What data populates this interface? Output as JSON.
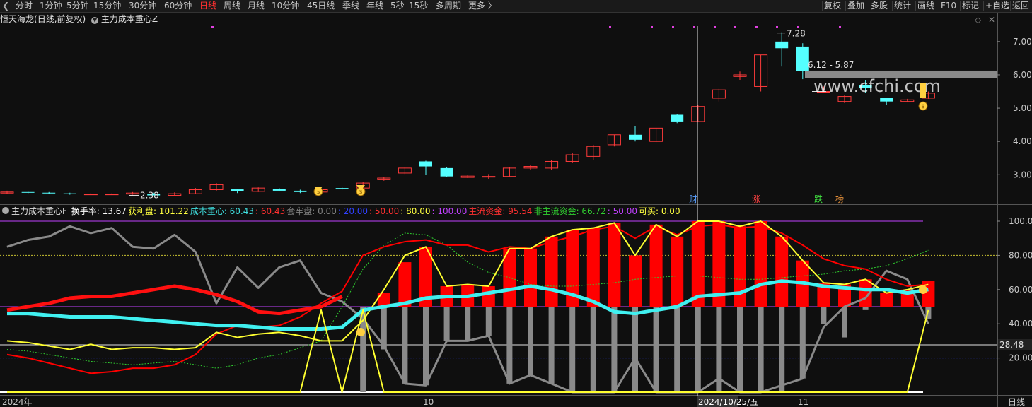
{
  "toolbar": {
    "back_icon": "back-arrow-icon",
    "periods": [
      "分时",
      "1分钟",
      "5分钟",
      "15分钟",
      "30分钟",
      "60分钟",
      "日线",
      "周线",
      "月线",
      "10分钟",
      "45日线",
      "季线",
      "年线",
      "5秒",
      "15秒",
      "多周期",
      "更多 〉"
    ],
    "active_period": "日线",
    "right_buttons": [
      "复权",
      "叠加",
      "多股",
      "统计",
      "画线",
      "F10",
      "标记",
      "+自选",
      "返回"
    ]
  },
  "stock_info": {
    "name": "恒天海龙",
    "mode": "(日线,前复权)",
    "indicator": "主力成本重心Z",
    "circle_icon": "dropdown-circle-icon"
  },
  "price_axis": [
    "7.00",
    "6.00",
    "5.00",
    "4.00",
    "3.00"
  ],
  "annotations": {
    "high": "7.28",
    "low": "2.38",
    "range": "6.12 - 5.87",
    "cai": "财",
    "zhang": "涨",
    "die": "跌",
    "bang": "榜",
    "watermark": "www.cfchi.com"
  },
  "indicator_title": {
    "name": "主力成本重心F",
    "items": [
      {
        "label": "换手率:",
        "value": "13.67",
        "color": "#ffffff"
      },
      {
        "label": "获利盘:",
        "value": "101.22",
        "color": "#ffff40"
      },
      {
        "label": "成本重心:",
        "value": "60.43",
        "color": "#40e0e0"
      },
      {
        "label": ":",
        "value": "60.43",
        "color": "#ff3030"
      },
      {
        "label": "套牢盘:",
        "value": "0.00",
        "color": "#808080"
      },
      {
        "label": ":",
        "value": "20.00",
        "color": "#3040ff"
      },
      {
        "label": ":",
        "value": "50.00",
        "color": "#ff3030"
      },
      {
        "label": ":",
        "value": "80.00",
        "color": "#ffff40"
      },
      {
        "label": ":",
        "value": "100.00",
        "color": "#c040ff"
      },
      {
        "label": "主流资金:",
        "value": "95.54",
        "color": "#ff3030"
      },
      {
        "label": "非主流资金:",
        "value": "66.72",
        "color": "#30d030"
      },
      {
        "label": ":",
        "value": "50.00",
        "color": "#c040ff"
      },
      {
        "label": "可买:",
        "value": "0.00",
        "color": "#ffff40"
      }
    ]
  },
  "indicator_axis": [
    "100.0",
    "80.00",
    "60.00",
    "40.00",
    "20.00"
  ],
  "crosshair_value": "28.48",
  "date_axis": {
    "labels": [
      "2024年",
      "10",
      "2024/10/25/五",
      "11"
    ],
    "period": "日线"
  },
  "colors": {
    "up": "#ff3b3b",
    "down": "#54ffff",
    "background": "#0f0f0f",
    "grid": "#333333"
  },
  "chart_data": {
    "type": "candlestick",
    "price_ylim": [
      2.2,
      7.4
    ],
    "candles": [
      {
        "o": 2.45,
        "c": 2.48,
        "h": 2.52,
        "l": 2.42
      },
      {
        "o": 2.48,
        "c": 2.46,
        "h": 2.5,
        "l": 2.43
      },
      {
        "o": 2.46,
        "c": 2.44,
        "h": 2.48,
        "l": 2.42
      },
      {
        "o": 2.44,
        "c": 2.42,
        "h": 2.46,
        "l": 2.4
      },
      {
        "o": 2.42,
        "c": 2.42,
        "h": 2.45,
        "l": 2.4
      },
      {
        "o": 2.42,
        "c": 2.42,
        "h": 2.44,
        "l": 2.4
      },
      {
        "o": 2.42,
        "c": 2.45,
        "h": 2.48,
        "l": 2.4
      },
      {
        "o": 2.42,
        "c": 2.38,
        "h": 2.46,
        "l": 2.38
      },
      {
        "o": 2.38,
        "c": 2.43,
        "h": 2.47,
        "l": 2.38
      },
      {
        "o": 2.43,
        "c": 2.55,
        "h": 2.6,
        "l": 2.42
      },
      {
        "o": 2.55,
        "c": 2.7,
        "h": 2.75,
        "l": 2.52
      },
      {
        "o": 2.56,
        "c": 2.5,
        "h": 2.58,
        "l": 2.45
      },
      {
        "o": 2.5,
        "c": 2.6,
        "h": 2.62,
        "l": 2.48
      },
      {
        "o": 2.57,
        "c": 2.52,
        "h": 2.6,
        "l": 2.5
      },
      {
        "o": 2.52,
        "c": 2.48,
        "h": 2.55,
        "l": 2.45
      },
      {
        "o": 2.48,
        "c": 2.55,
        "h": 2.6,
        "l": 2.46
      },
      {
        "o": 2.6,
        "c": 2.58,
        "h": 2.64,
        "l": 2.55
      },
      {
        "o": 2.6,
        "c": 2.75,
        "h": 2.78,
        "l": 2.58
      },
      {
        "o": 2.85,
        "c": 2.9,
        "h": 2.94,
        "l": 2.82
      },
      {
        "o": 3.05,
        "c": 3.2,
        "h": 3.22,
        "l": 3.02
      },
      {
        "o": 3.4,
        "c": 3.25,
        "h": 3.42,
        "l": 3.0
      },
      {
        "o": 3.2,
        "c": 2.95,
        "h": 3.22,
        "l": 2.93
      },
      {
        "o": 2.92,
        "c": 2.96,
        "h": 3.0,
        "l": 2.9
      },
      {
        "o": 2.95,
        "c": 2.95,
        "h": 3.02,
        "l": 2.88
      },
      {
        "o": 2.95,
        "c": 3.2,
        "h": 3.22,
        "l": 2.93
      },
      {
        "o": 3.2,
        "c": 3.25,
        "h": 3.3,
        "l": 3.15
      },
      {
        "o": 3.2,
        "c": 3.4,
        "h": 3.45,
        "l": 3.15
      },
      {
        "o": 3.4,
        "c": 3.6,
        "h": 3.65,
        "l": 3.35
      },
      {
        "o": 3.55,
        "c": 3.85,
        "h": 3.9,
        "l": 3.45
      },
      {
        "o": 3.9,
        "c": 4.2,
        "h": 4.2,
        "l": 3.85
      },
      {
        "o": 4.2,
        "c": 4.05,
        "h": 4.45,
        "l": 4.0
      },
      {
        "o": 4.0,
        "c": 4.4,
        "h": 4.4,
        "l": 3.98
      },
      {
        "o": 4.8,
        "c": 4.6,
        "h": 4.82,
        "l": 4.55
      },
      {
        "o": 4.6,
        "c": 5.05,
        "h": 5.1,
        "l": 4.58
      },
      {
        "o": 5.3,
        "c": 5.55,
        "h": 5.58,
        "l": 5.2
      },
      {
        "o": 5.95,
        "c": 6.0,
        "h": 6.1,
        "l": 5.85
      },
      {
        "o": 5.65,
        "c": 6.6,
        "h": 6.6,
        "l": 5.5
      },
      {
        "o": 7.0,
        "c": 6.8,
        "h": 7.28,
        "l": 6.25
      },
      {
        "o": 6.85,
        "c": 6.12,
        "h": 6.95,
        "l": 5.87
      },
      {
        "o": 5.5,
        "c": 5.5,
        "h": 5.65,
        "l": 5.45
      },
      {
        "o": 5.2,
        "c": 5.35,
        "h": 5.4,
        "l": 5.15
      },
      {
        "o": 5.7,
        "c": 5.6,
        "h": 5.85,
        "l": 5.45
      },
      {
        "o": 5.3,
        "c": 5.2,
        "h": 5.32,
        "l": 5.1
      },
      {
        "o": 5.2,
        "c": 5.25,
        "h": 5.28,
        "l": 5.18
      },
      {
        "o": 5.3,
        "c": 5.45,
        "h": 5.5,
        "l": 5.28
      }
    ],
    "indicator_ylim": [
      0,
      105
    ],
    "hist_red": [
      null,
      null,
      null,
      null,
      null,
      null,
      null,
      null,
      null,
      null,
      null,
      null,
      null,
      null,
      null,
      null,
      null,
      null,
      58,
      76,
      85,
      62,
      63,
      62,
      84,
      84,
      91,
      95,
      96,
      99,
      80,
      98,
      91,
      100,
      100,
      97,
      100,
      91,
      77,
      64,
      63,
      66,
      58,
      60,
      65
    ],
    "hist_gray": [
      null,
      null,
      null,
      null,
      null,
      null,
      null,
      null,
      null,
      null,
      null,
      null,
      null,
      null,
      null,
      null,
      null,
      0,
      25,
      5,
      4,
      30,
      30,
      33,
      5,
      10,
      5,
      0,
      0,
      0,
      0,
      0,
      0,
      0,
      0,
      0,
      0,
      0,
      8,
      40,
      32,
      48,
      54,
      58,
      43
    ],
    "gray_line": [
      85,
      89,
      91,
      97,
      93,
      96,
      85,
      84,
      92,
      82,
      52,
      73,
      61,
      73,
      77,
      58,
      53,
      43,
      27,
      5,
      4,
      30,
      30,
      33,
      5,
      10,
      5,
      0,
      0,
      0,
      20,
      0,
      0,
      0,
      8,
      0,
      0,
      4,
      8,
      38,
      50,
      55,
      71,
      66,
      40
    ],
    "cyan_line": [
      46,
      46,
      45,
      44,
      44,
      44,
      43,
      42,
      41,
      40,
      39,
      39,
      38,
      37,
      37,
      37,
      38,
      48,
      50,
      52,
      55,
      56,
      56,
      58,
      60,
      62,
      60,
      57,
      53,
      47,
      46,
      48,
      50,
      56,
      57,
      58,
      63,
      65,
      64,
      62,
      61,
      60,
      60,
      58,
      60
    ],
    "red_line": [
      22,
      20,
      17,
      14,
      11,
      12,
      14,
      14,
      16,
      22,
      34,
      39,
      38,
      39,
      44,
      52,
      59,
      80,
      85,
      88,
      89,
      86,
      86,
      82,
      85,
      84,
      88,
      91,
      95,
      97,
      90,
      97,
      92,
      97,
      98,
      96,
      97,
      93,
      86,
      78,
      74,
      72,
      66,
      62,
      63
    ],
    "yellow_line": [
      30,
      29,
      27,
      25,
      28,
      25,
      26,
      26,
      25,
      26,
      35,
      32,
      34,
      35,
      33,
      30,
      30,
      42,
      60,
      80,
      85,
      62,
      63,
      62,
      84,
      84,
      91,
      95,
      96,
      99,
      80,
      98,
      91,
      100,
      100,
      97,
      100,
      91,
      77,
      64,
      63,
      66,
      58,
      60,
      63
    ],
    "green_dotted": [
      25,
      24,
      22,
      20,
      18,
      17,
      16,
      17,
      18,
      16,
      14,
      16,
      20,
      22,
      26,
      30,
      50,
      72,
      86,
      93,
      92,
      86,
      76,
      70,
      67,
      63,
      62,
      62,
      63,
      64,
      66,
      67,
      68,
      68,
      67,
      66,
      66,
      67,
      68,
      69,
      71,
      72,
      74,
      78,
      83
    ],
    "buy_line": [
      0,
      0,
      0,
      0,
      0,
      0,
      0,
      0,
      0,
      0,
      0,
      0,
      0,
      0,
      0,
      48,
      0,
      48,
      0,
      0,
      0,
      0,
      0,
      0,
      0,
      0,
      0,
      0,
      0,
      0,
      0,
      0,
      0,
      0,
      0,
      0,
      0,
      0,
      0,
      0,
      0,
      0,
      0,
      0,
      48
    ],
    "ref_lines": [
      20,
      50,
      80,
      100
    ]
  }
}
